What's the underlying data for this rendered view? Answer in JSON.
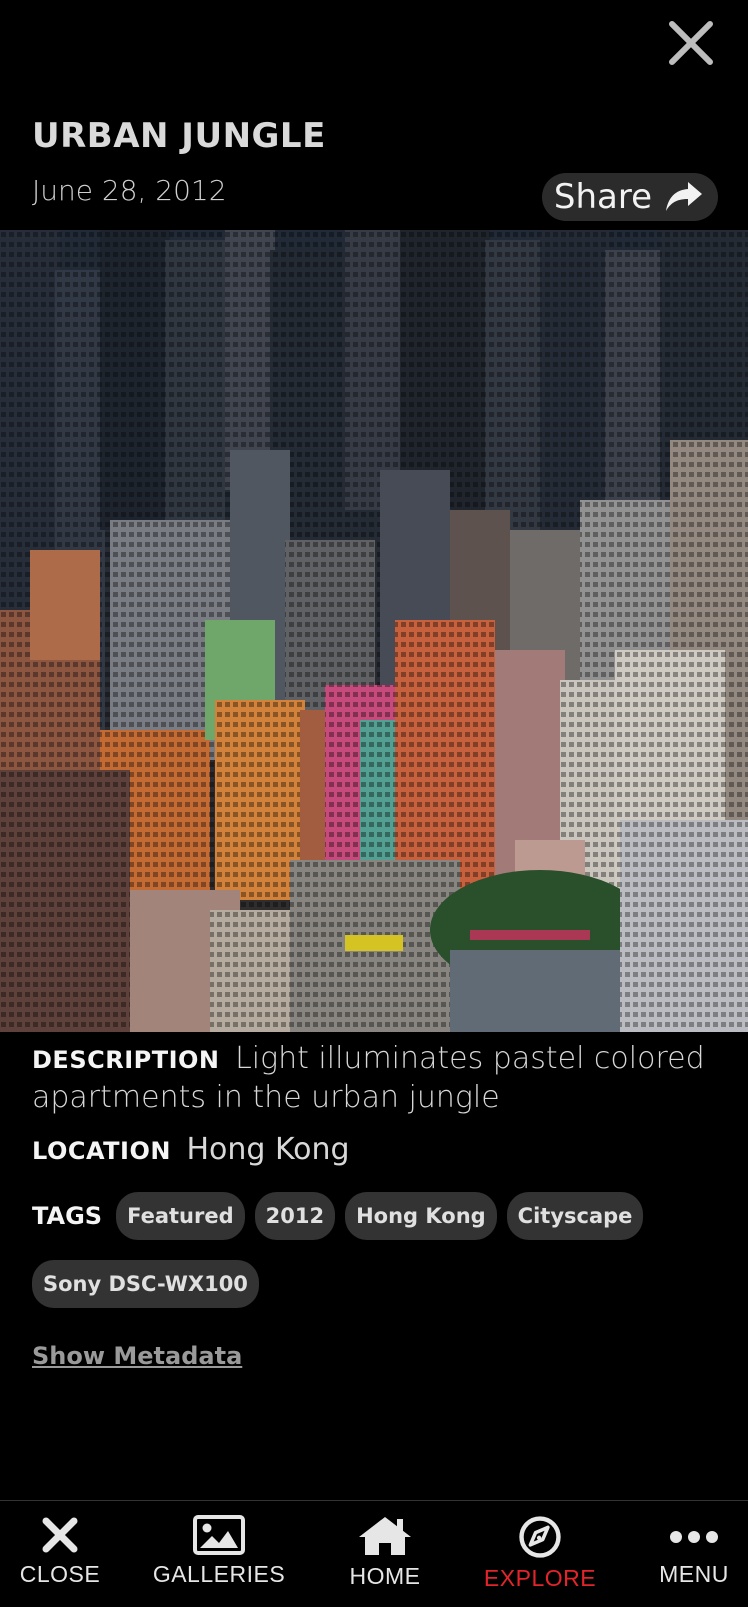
{
  "header": {
    "title": "URBAN JUNGLE",
    "date": "June 28, 2012",
    "share_label": "Share"
  },
  "photo": {
    "alt": "Light illuminates pastel colored apartments in the urban jungle"
  },
  "details": {
    "description_label": "DESCRIPTION",
    "description": "Light illuminates pastel colored apartments in the urban jungle",
    "location_label": "LOCATION",
    "location": "Hong Kong",
    "tags_label": "TAGS",
    "tags": [
      "Featured",
      "2012",
      "Hong Kong",
      "Cityscape",
      "Sony DSC-WX100"
    ],
    "show_metadata": "Show Metadata"
  },
  "bottom_nav": {
    "items": [
      {
        "label": "CLOSE",
        "icon": "close-icon",
        "active": false
      },
      {
        "label": "GALLERIES",
        "icon": "image-icon",
        "active": false
      },
      {
        "label": "HOME",
        "icon": "home-icon",
        "active": false
      },
      {
        "label": "EXPLORE",
        "icon": "compass-icon",
        "active": true
      },
      {
        "label": "MENU",
        "icon": "more-icon",
        "active": false
      }
    ],
    "active_color": "#e3242b"
  }
}
